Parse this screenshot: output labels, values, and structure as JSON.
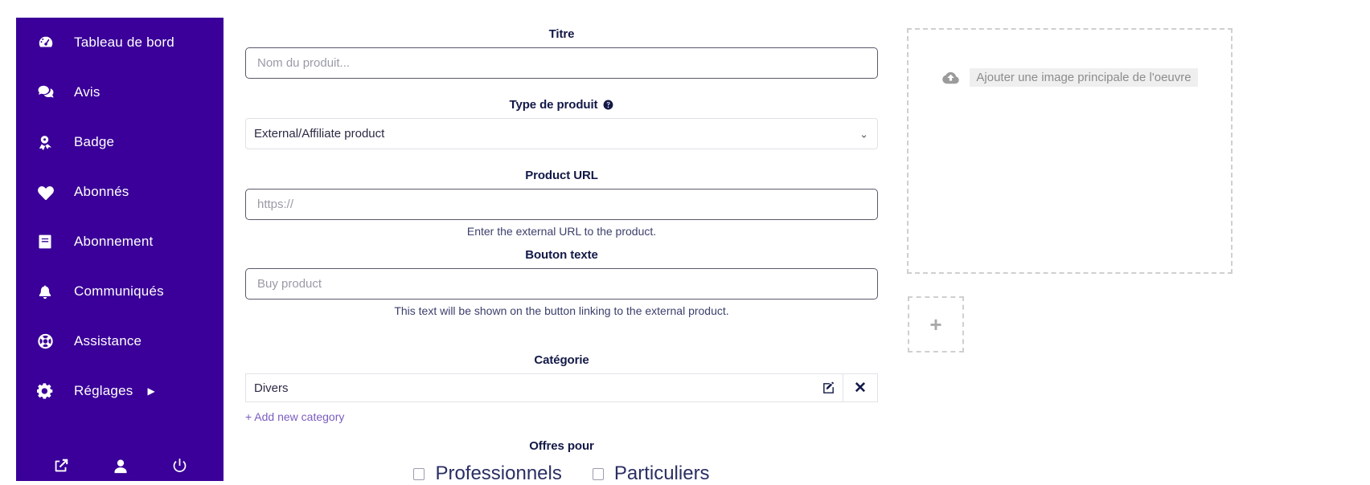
{
  "theme": {
    "sidebar_bg": "#3a0099",
    "label_color": "#131947",
    "link_color": "#7a5cc0",
    "placeholder_color": "#9a9aa8"
  },
  "sidebar": {
    "items": [
      {
        "label": "Tableau de bord",
        "icon": "dashboard-gauge-icon"
      },
      {
        "label": "Avis",
        "icon": "comments-icon"
      },
      {
        "label": "Badge",
        "icon": "award-badge-icon"
      },
      {
        "label": "Abonnés",
        "icon": "heart-icon"
      },
      {
        "label": "Abonnement",
        "icon": "book-icon"
      },
      {
        "label": "Communiqués",
        "icon": "bell-icon"
      },
      {
        "label": "Assistance",
        "icon": "lifebuoy-icon"
      },
      {
        "label": "Réglages",
        "icon": "gear-icon",
        "caret": "▶"
      }
    ],
    "bottom_icons": [
      {
        "name": "external-link-icon"
      },
      {
        "name": "user-icon"
      },
      {
        "name": "power-icon"
      }
    ]
  },
  "form": {
    "title_field": {
      "label": "Titre",
      "placeholder": "Nom du produit...",
      "value": ""
    },
    "product_type_field": {
      "label": "Type de produit",
      "help_icon": "question-circle-icon",
      "selected": "External/Affiliate product",
      "options": [
        "External/Affiliate product"
      ],
      "chevron": "⌄"
    },
    "product_url_field": {
      "label": "Product URL",
      "placeholder": "https://",
      "value": "",
      "help_text": "Enter the external URL to the product."
    },
    "button_text_field": {
      "label": "Bouton texte",
      "placeholder": "Buy product",
      "value": "",
      "help_text": "This text will be shown on the button linking to the external product."
    },
    "category_field": {
      "label": "Catégorie",
      "value": "Divers",
      "edit_icon": "edit-pencil-square-icon",
      "remove_icon": "close-x-icon",
      "remove_label": "✕",
      "add_link": "+ Add new category"
    },
    "offers_field": {
      "label": "Offres pour",
      "options": [
        {
          "label": "Professionnels",
          "checked": false
        },
        {
          "label": "Particuliers",
          "checked": false
        }
      ]
    }
  },
  "media": {
    "main_dropzone": {
      "label": "Ajouter une image principale de l'oeuvre",
      "icon": "cloud-upload-icon"
    },
    "add_more": {
      "plus": "+",
      "icon": "plus-icon"
    }
  }
}
